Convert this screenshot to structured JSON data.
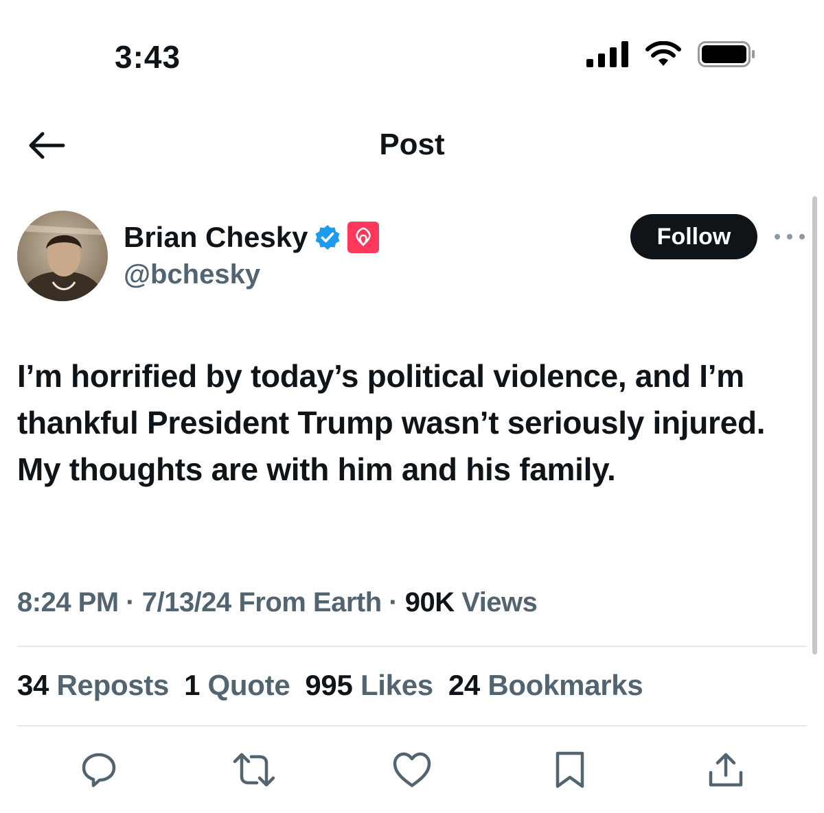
{
  "status_bar": {
    "time": "3:43"
  },
  "nav": {
    "title": "Post"
  },
  "author": {
    "name": "Brian Chesky",
    "handle": "@bchesky",
    "follow_label": "Follow"
  },
  "post": {
    "text": "I’m horrified by today’s political violence, and I’m thankful President Trump wasn’t seriously injured. My thoughts are with him and his family.",
    "time": "8:24 PM",
    "date": "7/13/24",
    "source": "From Earth",
    "views_count": "90K",
    "views_label": "Views"
  },
  "stats": [
    {
      "count": "34",
      "label": "Reposts"
    },
    {
      "count": "1",
      "label": "Quote"
    },
    {
      "count": "995",
      "label": "Likes"
    },
    {
      "count": "24",
      "label": "Bookmarks"
    }
  ],
  "colors": {
    "text": "#0f1419",
    "secondary": "#536471",
    "verified": "#1d9bf0",
    "affiliate": "#ff385c"
  },
  "icons": [
    "back-arrow-icon",
    "verified-badge-icon",
    "airbnb-logo-icon",
    "more-icon",
    "reply-icon",
    "repost-icon",
    "like-icon",
    "bookmark-icon",
    "share-icon"
  ]
}
